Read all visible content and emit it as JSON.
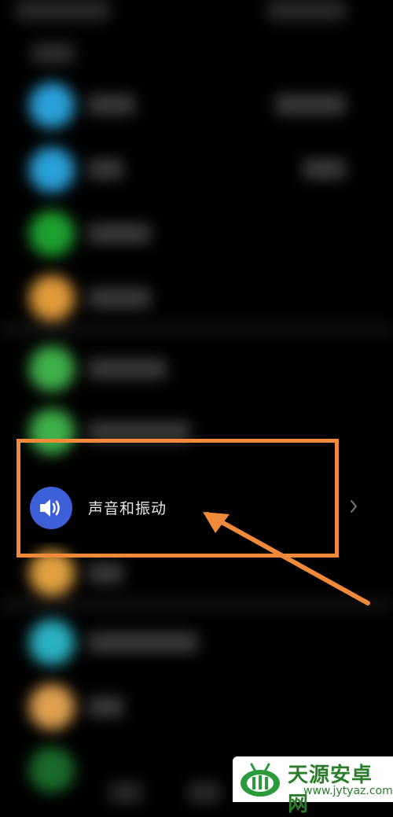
{
  "settings": {
    "highlighted_item": {
      "label": "声音和振动",
      "icon": "speaker-icon",
      "icon_color": "#3d5fd8"
    },
    "blurred_icon_colors": [
      "#2aa0d8",
      "#2aa0d8",
      "#1ea030",
      "#e09a3a",
      "#3fb04a",
      "#3fb04a",
      "#e0a040",
      "#2ab0c0",
      "#e0a050",
      "#1a8a2a"
    ]
  },
  "annotation": {
    "box_color": "#f08a3a",
    "arrow_color": "#f08a3a"
  },
  "watermark": {
    "title": "天源安卓网",
    "url": "www.jytyaz.com",
    "color": "#2a7d2a"
  }
}
